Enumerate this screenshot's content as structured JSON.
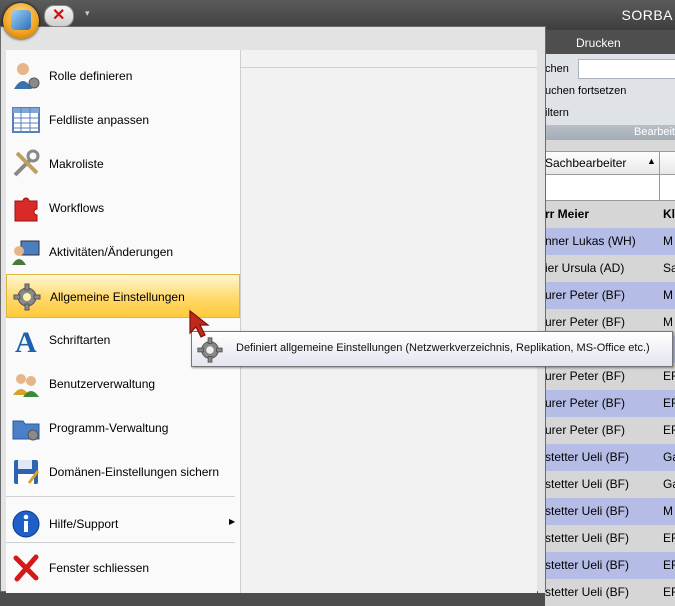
{
  "app_title": "SORBA",
  "quick_access": {
    "orb_icon": "app-cube-icon",
    "close_icon": "red-x-icon",
    "dropdown": "▾"
  },
  "ribbon": {
    "tab_label": "Drucken",
    "search_label": "chen",
    "continue_label": "uchen fortsetzen",
    "filter_label": "iltern",
    "group_label": "Bearbeit"
  },
  "grid": {
    "header_col1": "Sachbearbeiter",
    "sort_indicator": "▲",
    "rows": [
      {
        "c1": "rr Meier",
        "c2": "Kl",
        "style": "bold"
      },
      {
        "c1": "nner Lukas (WH)",
        "c2": "M",
        "style": "hl"
      },
      {
        "c1": "ier Ursula (AD)",
        "c2": "Sa",
        "style": "wh"
      },
      {
        "c1": "urer Peter (BF)",
        "c2": "M",
        "style": "hl"
      },
      {
        "c1": "urer Peter (BF)",
        "c2": "M",
        "style": "wh"
      },
      {
        "c1": "",
        "c2": "",
        "style": "hl"
      },
      {
        "c1": "urer Peter (BF)",
        "c2": "EF",
        "style": "wh"
      },
      {
        "c1": "urer Peter (BF)",
        "c2": "EF",
        "style": "hl"
      },
      {
        "c1": "urer Peter (BF)",
        "c2": "EF",
        "style": "wh"
      },
      {
        "c1": "stetter Ueli (BF)",
        "c2": "Ga",
        "style": "hl"
      },
      {
        "c1": "stetter Ueli (BF)",
        "c2": "Ga",
        "style": "wh"
      },
      {
        "c1": "stetter Ueli (BF)",
        "c2": "M",
        "style": "hl"
      },
      {
        "c1": "stetter Ueli (BF)",
        "c2": "EF",
        "style": "wh"
      },
      {
        "c1": "stetter Ueli (BF)",
        "c2": "EF",
        "style": "hl"
      },
      {
        "c1": "stetter Ueli (BF)",
        "c2": "EF",
        "style": "wh"
      }
    ]
  },
  "menu": {
    "items": [
      {
        "label": "Rolle definieren",
        "icon": "user-gear-icon"
      },
      {
        "label": "Feldliste anpassen",
        "icon": "table-grid-icon"
      },
      {
        "label": "Makroliste",
        "icon": "tools-icon"
      },
      {
        "label": "Workflows",
        "icon": "puzzle-icon"
      },
      {
        "label": "Aktivitäten/Änderungen",
        "icon": "user-monitor-icon"
      },
      {
        "label": "Allgemeine Einstellungen",
        "icon": "gear-icon"
      },
      {
        "label": "Schriftarten",
        "icon": "font-icon"
      },
      {
        "label": "Benutzerverwaltung",
        "icon": "users-icon"
      },
      {
        "label": "Programm-Verwaltung",
        "icon": "folder-gear-icon"
      },
      {
        "label": "Domänen-Einstellungen sichern",
        "icon": "save-disk-icon"
      },
      {
        "label": "Hilfe/Support",
        "icon": "info-icon"
      },
      {
        "label": "Fenster schliessen",
        "icon": "close-x-icon"
      }
    ],
    "submenu_arrow": "▶"
  },
  "tooltip": {
    "text": "Definiert allgemeine Einstellungen (Netzwerkverzeichnis, Replikation, MS-Office etc.)",
    "icon": "gear-icon"
  },
  "colors": {
    "highlight_row": "#b5bde6",
    "active_item": "#ffd96b",
    "titlebar": "#4a4a4a"
  }
}
